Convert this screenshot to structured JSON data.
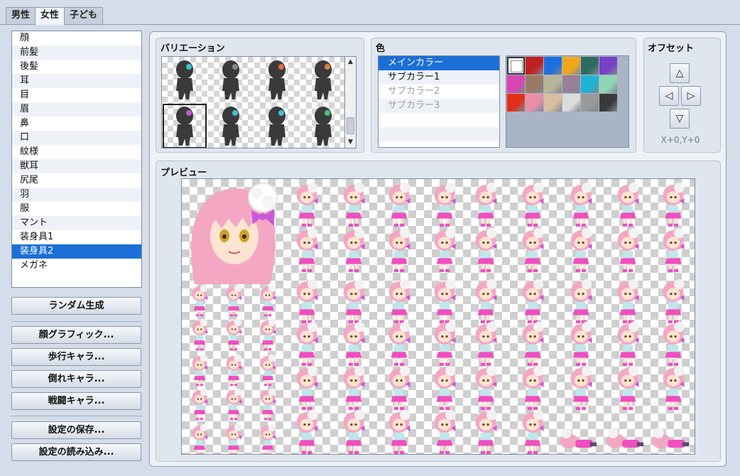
{
  "tabs": [
    {
      "label": "男性",
      "active": false
    },
    {
      "label": "女性",
      "active": true
    },
    {
      "label": "子ども",
      "active": false
    }
  ],
  "parts": {
    "items": [
      "顔",
      "前髪",
      "後髪",
      "耳",
      "目",
      "眉",
      "鼻",
      "口",
      "紋様",
      "獣耳",
      "尻尾",
      "羽",
      "服",
      "マント",
      "装身具1",
      "装身具2",
      "メガネ"
    ],
    "selected_index": 15
  },
  "buttons": {
    "random": "ランダム生成",
    "face_graphic": "顔グラフィック...",
    "walk_char": "歩行キャラ...",
    "down_char": "倒れキャラ...",
    "battle_char": "戦闘キャラ...",
    "save_settings": "設定の保存...",
    "load_settings": "設定の読み込み..."
  },
  "variation": {
    "title": "バリエーション",
    "selected_index": 4,
    "accent_colors": [
      "#3fc0d8",
      "#888888",
      "#e46b3c",
      "#d8823c",
      "#c25bd0",
      "#3fc0d8",
      "#3fc0d8",
      "#44c07a"
    ]
  },
  "color": {
    "title": "色",
    "items": [
      {
        "label": "メインカラー",
        "state": "selected"
      },
      {
        "label": "サブカラー1",
        "state": "normal"
      },
      {
        "label": "サブカラー2",
        "state": "disabled"
      },
      {
        "label": "サブカラー3",
        "state": "disabled"
      }
    ],
    "palette": [
      [
        "#ffffff",
        "#c21f1f",
        "#1b6fe0",
        "#f0a81a",
        "#2f6b62",
        "#7a3fc9"
      ],
      [
        "#d946b3",
        "#9a7a63",
        "#b5b59a",
        "#9a7f99",
        "#1fb3d6",
        "#8fd6b2"
      ],
      [
        "#e0301a",
        "#e78fa8",
        "#d9bfa0",
        "#dcdcdc",
        "#9a9a9a",
        "#3a3a3a"
      ]
    ],
    "selected_swatch": [
      0,
      0
    ]
  },
  "offset": {
    "title": "オフセット",
    "up": "△",
    "left": "◁",
    "right": "▷",
    "down": "▽",
    "value_text": "X+0,Y+0"
  },
  "preview": {
    "title": "プレビュー",
    "hair_color": "#f3a7c3",
    "outfit_color": "#ef4fbf",
    "bow_color": "#c85ad8"
  }
}
